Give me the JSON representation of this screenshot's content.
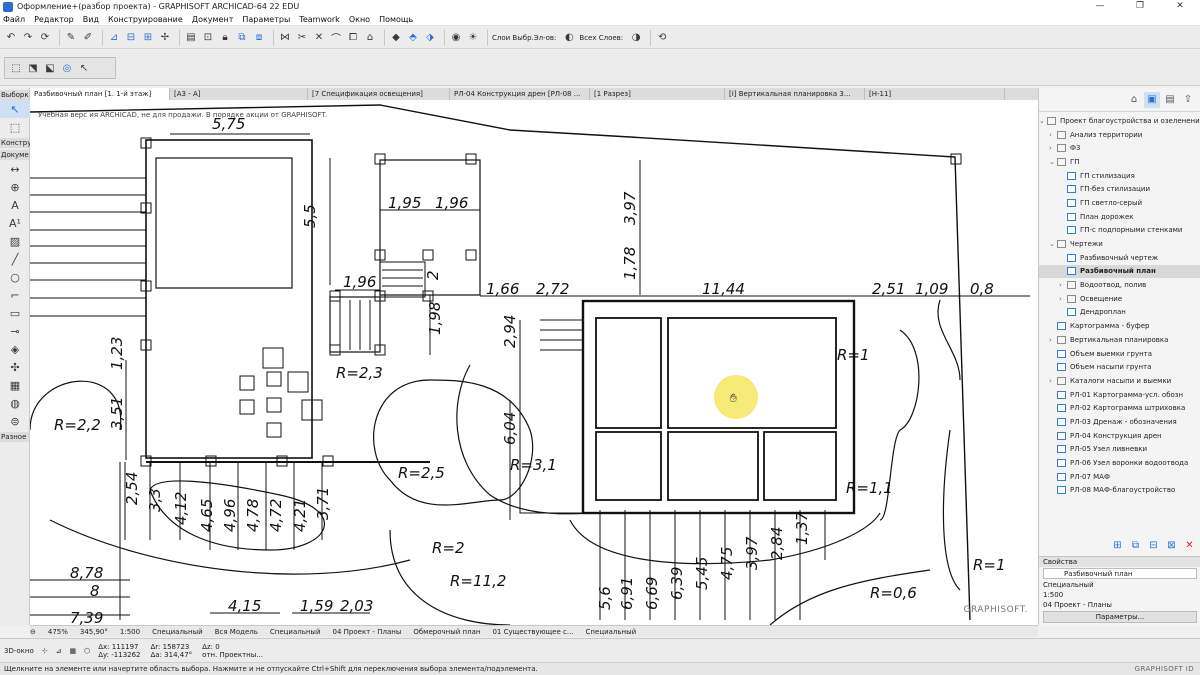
{
  "window": {
    "title": "Оформление+(разбор проекта) - GRAPHISOFT ARCHICAD-64 22 EDU",
    "controls": [
      "—",
      "❐",
      "✕"
    ]
  },
  "menu": [
    "Файл",
    "Редактор",
    "Вид",
    "Конструирование",
    "Документ",
    "Параметры",
    "Teamwork",
    "Окно",
    "Помощь"
  ],
  "toolbar": {
    "layers_label": "Слои Выбр.Эл-ов:",
    "all_layers_label": "Всех Слоев:"
  },
  "toolbox": {
    "select_header": "Выборк",
    "construct_header": "Констру",
    "document_header": "Докуме",
    "misc_header": "Разное"
  },
  "tabs": [
    "Разбивочный план [1. 1-й этаж]",
    "[A3 - A]",
    "[7 Спецификация освещения]",
    "РЛ-04 Конструкция дрен [РЛ-08 ...",
    "[1 Разрез]",
    "[I] Вертикальная планировка 3...",
    "[Н-11]"
  ],
  "canvas": {
    "edu_note": "Учебная верс ия ARCHICAD, не для продажи. В порядке акции от GRAPHISOFT.",
    "brand": "GRAPHISOFT.",
    "dims": {
      "d1": "5,75",
      "d2": "5,5",
      "d3": "3,97",
      "d4": "1,95",
      "d5": "1,96",
      "d6": "1,78",
      "d7": "1,96",
      "d8": "2",
      "d9": "1,98",
      "d10": "1,66",
      "d11": "2,72",
      "d12": "11,44",
      "d13": "2,51",
      "d14": "1,09",
      "d15": "0,8",
      "d16": "2,94",
      "d17": "1,23",
      "d18": "3,51",
      "d19": "R=2,2",
      "d20": "R=2,3",
      "d21": "R=1",
      "d22": "6,04",
      "d23": "R=3,1",
      "d24": "R=2,5",
      "d25": "R=1,1",
      "d26": "2,54",
      "d27": "3,3",
      "d28": "4,12",
      "d29": "4,65",
      "d30": "4,96",
      "d31": "4,78",
      "d32": "4,72",
      "d33": "4,21",
      "d34": "3,71",
      "d35": "R=2",
      "d36": "8,78",
      "d37": "8",
      "d38": "R=11,2",
      "d39": "7,39",
      "d40": "4,15",
      "d41": "1,59",
      "d42": "2,03",
      "d43": "5,6",
      "d44": "6,91",
      "d45": "6,69",
      "d46": "6,39",
      "d47": "5,45",
      "d48": "4,75",
      "d49": "3,97",
      "d50": "2,84",
      "d51": "1,37",
      "d52": "R=0,6",
      "d53": "R=1"
    }
  },
  "navigator": {
    "root": "Проект благоустройства и озеленения \"",
    "items": [
      {
        "label": "Анализ территории",
        "type": "folder",
        "level": 1,
        "arrow": "›"
      },
      {
        "label": "Ф3",
        "type": "folder",
        "level": 1,
        "arrow": "›"
      },
      {
        "label": "ГП",
        "type": "folder",
        "level": 1,
        "arrow": "⌄"
      },
      {
        "label": "ГП стилизация",
        "type": "view",
        "level": 2
      },
      {
        "label": "ГП-без стилизации",
        "type": "view",
        "level": 2
      },
      {
        "label": "ГП светло-серый",
        "type": "view",
        "level": 2
      },
      {
        "label": "План дорожек",
        "type": "view",
        "level": 2
      },
      {
        "label": "ГП-с подпорными стенками",
        "type": "view",
        "level": 2
      },
      {
        "label": "Чертежи",
        "type": "folder",
        "level": 1,
        "arrow": "⌄"
      },
      {
        "label": "Разбивочный чертеж",
        "type": "view",
        "level": 2
      },
      {
        "label": "Разбивочный план",
        "type": "view",
        "level": 2,
        "selected": true
      },
      {
        "label": "Водоотвод, полив",
        "type": "folder",
        "level": 2,
        "arrow": "›"
      },
      {
        "label": "Освещение",
        "type": "folder",
        "level": 2,
        "arrow": "›"
      },
      {
        "label": "Дендроплан",
        "type": "view",
        "level": 2
      },
      {
        "label": "Картограмма - буфер",
        "type": "view",
        "level": 1
      },
      {
        "label": "Вертикальная планировка",
        "type": "folder",
        "level": 1,
        "arrow": "›"
      },
      {
        "label": "Объем выемки грунта",
        "type": "view",
        "level": 1
      },
      {
        "label": "Объем насыпи грунта",
        "type": "view",
        "level": 1
      },
      {
        "label": "Каталоги насыпи и выемки",
        "type": "folder",
        "level": 1,
        "arrow": "›"
      },
      {
        "label": "РЛ-01 Картограмма-усл. обозн",
        "type": "view",
        "level": 1
      },
      {
        "label": "РЛ-02 Картограмма штриховка",
        "type": "view",
        "level": 1
      },
      {
        "label": "РЛ-03 Дренаж - обозначения",
        "type": "view",
        "level": 1
      },
      {
        "label": "РЛ-04 Конструкция дрен",
        "type": "view",
        "level": 1
      },
      {
        "label": "РЛ-05 Узел ливневки",
        "type": "view",
        "level": 1
      },
      {
        "label": "РЛ-06 Узел воронки водоотвода",
        "type": "view",
        "level": 1
      },
      {
        "label": "РЛ-07 МАФ",
        "type": "view",
        "level": 1
      },
      {
        "label": "РЛ-08 МАФ-благоустройство",
        "type": "view",
        "level": 1
      }
    ]
  },
  "properties": {
    "header": "Свойства",
    "name": "Разбивочный план",
    "type": "Специальный",
    "scale": "1:500",
    "layer_combo": "04 Проект - Планы",
    "button": "Параметры..."
  },
  "canvas_bar": {
    "zoom": "475%",
    "angle": "345,90°",
    "scale": "1:500",
    "pen": "Специальный",
    "model": "Вся Модель",
    "pen2": "Специальный",
    "layers": "04 Проект - Планы",
    "dims": "Обмерочный план",
    "renovation": "01 Существующее с...",
    "pen3": "Специальный"
  },
  "infobar": {
    "view3d": "3D-окно",
    "dx": "Δx: 111197",
    "dy": "Δy: -113262",
    "ar": "Δr: 158723",
    "aa": "Δa: 314,47°",
    "az": "Δz: 0",
    "ref": "отн. Проектны..."
  },
  "status": {
    "message": "Щелкните на элементе или начертите область выбора. Нажмите и не отпускайте Ctrl+Shift для переключения выбора элемента/подэлемента.",
    "brand": "GRAPHISOFT ID"
  }
}
